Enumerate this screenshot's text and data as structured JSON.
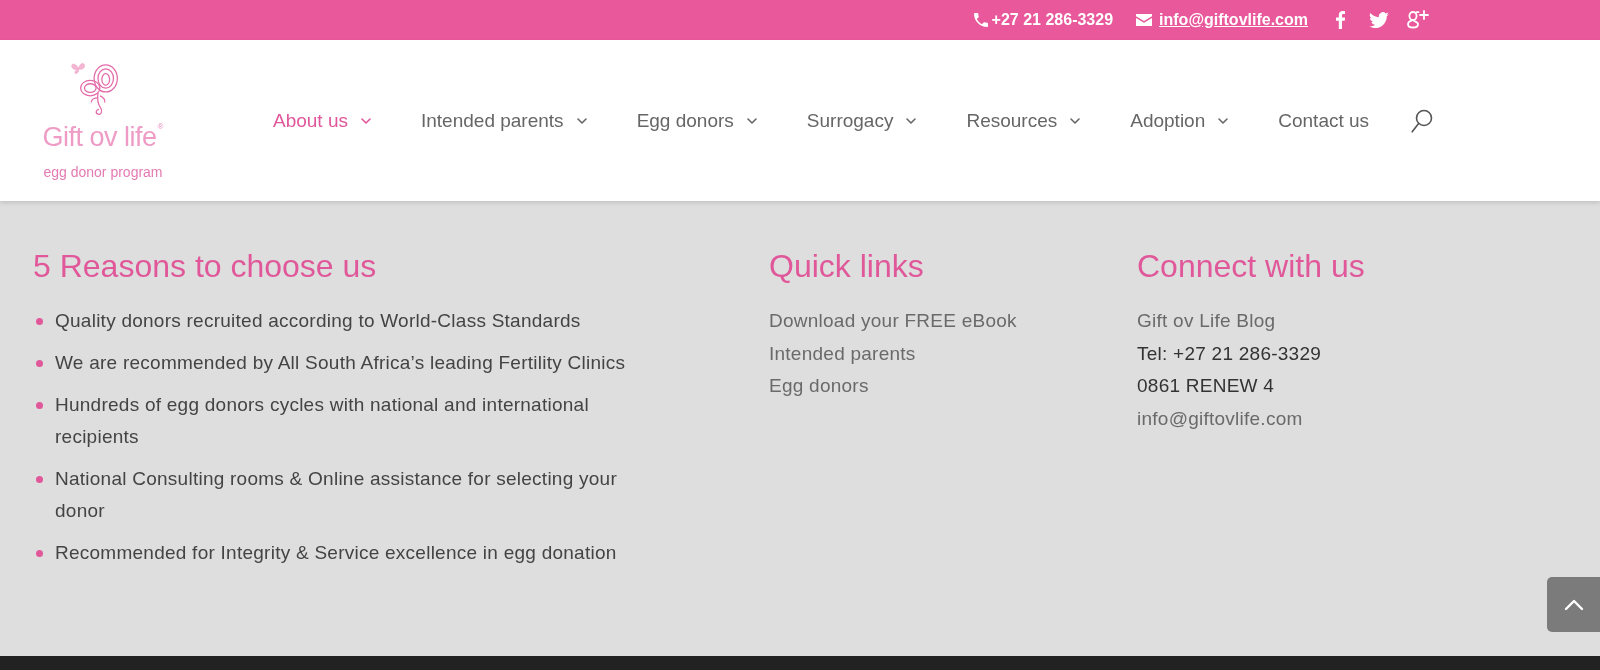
{
  "top_bar": {
    "phone": "+27 21 286-3329",
    "email": "info@giftovlife.com"
  },
  "header": {
    "logo": {
      "name": "Gift ov life",
      "mark": "®",
      "tagline": "egg donor program"
    },
    "nav": [
      {
        "label": "About us",
        "selected": true,
        "dropdown": true
      },
      {
        "label": "Intended parents",
        "selected": false,
        "dropdown": true
      },
      {
        "label": "Egg donors",
        "selected": false,
        "dropdown": true
      },
      {
        "label": "Surrogacy",
        "selected": false,
        "dropdown": true
      },
      {
        "label": "Resources",
        "selected": false,
        "dropdown": true
      },
      {
        "label": "Adoption",
        "selected": false,
        "dropdown": true
      },
      {
        "label": "Contact us",
        "selected": false,
        "dropdown": false
      }
    ]
  },
  "footer": {
    "reasons": {
      "title": "5 Reasons to choose us",
      "items": [
        "Quality donors recruited according to World-Class Standards",
        "We are recommended by All South Africa’s leading Fertility Clinics",
        "Hundreds of egg donors cycles with national and international recipients",
        "National Consulting rooms & Online assistance for selecting your donor",
        "Recommended for Integrity & Service excellence in egg donation"
      ]
    },
    "quick_links": {
      "title": "Quick links",
      "items": [
        "Download your FREE eBook",
        "Intended parents",
        "Egg donors"
      ]
    },
    "connect": {
      "title": "Connect with us",
      "items": [
        {
          "text": "Gift ov Life Blog",
          "kind": "link"
        },
        {
          "text": "Tel: +27 21 286-3329",
          "kind": "text"
        },
        {
          "text": "0861 RENEW 4",
          "kind": "text"
        },
        {
          "text": "info@giftovlife.com",
          "kind": "link"
        }
      ]
    }
  }
}
